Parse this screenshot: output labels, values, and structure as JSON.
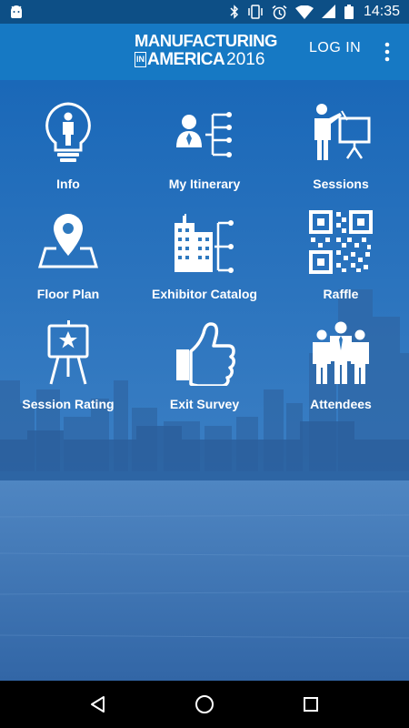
{
  "status_bar": {
    "time": "14:35",
    "icons": [
      "android-icon",
      "bluetooth-icon",
      "vibrate-icon",
      "alarm-icon",
      "wifi-icon",
      "signal-icon",
      "battery-icon"
    ]
  },
  "app_bar": {
    "brand_line1": "MANUFACTURING",
    "brand_in": "IN",
    "brand_america": "AMERICA",
    "brand_year": "2016",
    "login_label": "LOG IN",
    "overflow_icon": "more-vert-icon"
  },
  "menu": {
    "items": [
      {
        "label": "Info",
        "icon": "lightbulb-person-icon"
      },
      {
        "label": "My Itinerary",
        "icon": "person-hierarchy-icon"
      },
      {
        "label": "Sessions",
        "icon": "presenter-board-icon"
      },
      {
        "label": "Floor Plan",
        "icon": "map-pin-icon"
      },
      {
        "label": "Exhibitor Catalog",
        "icon": "building-hierarchy-icon"
      },
      {
        "label": "Raffle",
        "icon": "qr-code-icon"
      },
      {
        "label": "Session Rating",
        "icon": "star-easel-icon"
      },
      {
        "label": "Exit Survey",
        "icon": "thumbs-up-icon"
      },
      {
        "label": "Attendees",
        "icon": "group-people-icon"
      }
    ]
  },
  "nav_bar": {
    "back_icon": "back-triangle-icon",
    "home_icon": "home-circle-icon",
    "recents_icon": "recents-square-icon"
  },
  "colors": {
    "status_bar": "#0d4f86",
    "app_bar": "#1679c4",
    "background": "#2e79bf"
  }
}
